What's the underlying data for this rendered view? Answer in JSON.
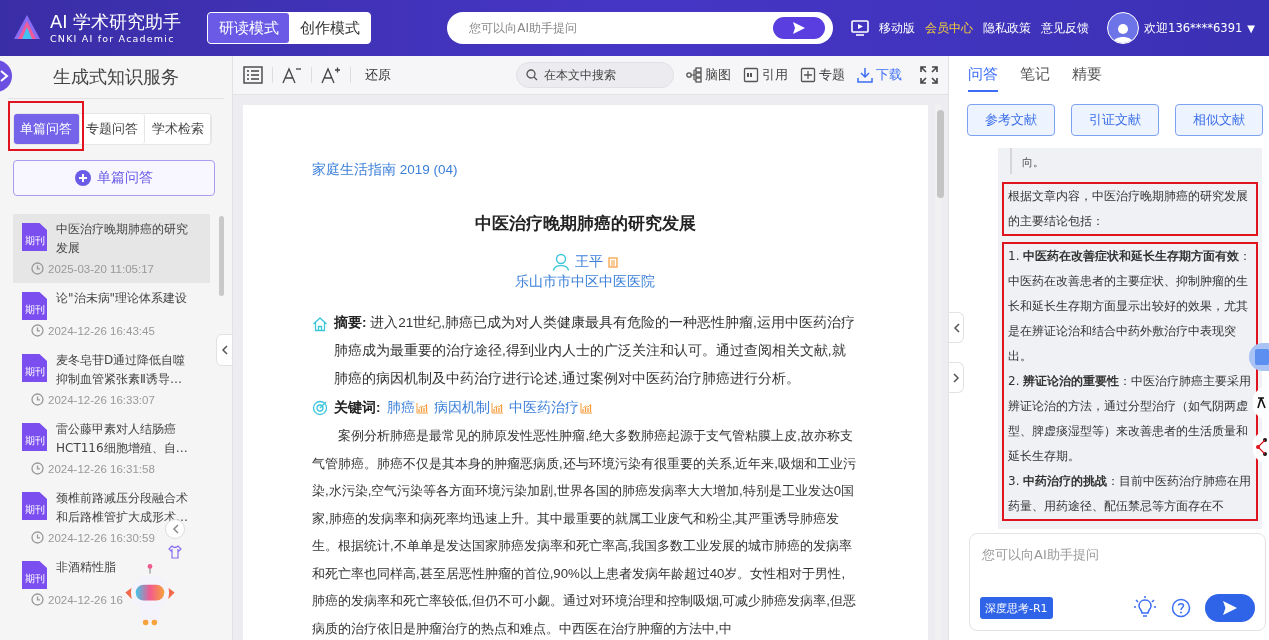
{
  "header": {
    "logo_title": "AI 学术研究助手",
    "logo_subtitle": "CNKI AI for Academic",
    "modes": [
      {
        "label": "研读模式",
        "selected": true
      },
      {
        "label": "创作模式",
        "selected": false
      }
    ],
    "search": {
      "placeholder": "您可以向AI助手提问"
    },
    "links": [
      {
        "label": "移动版",
        "kind": "mobile"
      },
      {
        "label": "会员中心",
        "kind": "member"
      },
      {
        "label": "隐私政策",
        "kind": "plain"
      },
      {
        "label": "意见反馈",
        "kind": "plain"
      }
    ],
    "user": "欢迎136****6391",
    "dropdown": "▼"
  },
  "sidebar": {
    "title": "生成式知识服务",
    "tabs": [
      {
        "label": "单篇问答",
        "selected": true,
        "framed": true
      },
      {
        "label": "专题问答",
        "selected": false,
        "framed": false
      },
      {
        "label": "学术检索",
        "selected": false,
        "framed": false
      }
    ],
    "new_button": "单篇问答",
    "history": [
      {
        "badge": "期刊",
        "title": "中医治疗晚期肺癌的研究发展",
        "time": "2025-03-20 11:05:17",
        "selected": true
      },
      {
        "badge": "期刊",
        "title": "论\"治未病\"理论体系建设",
        "time": "2024-12-26 16:43:45",
        "selected": false
      },
      {
        "badge": "期刊",
        "title": "麦冬皂苷D通过降低自噬抑制血管紧张素Ⅱ诱导…",
        "time": "2024-12-26 16:33:07",
        "selected": false
      },
      {
        "badge": "期刊",
        "title": "雷公藤甲素对人结肠癌HCT116细胞增殖、自…",
        "time": "2024-12-26 16:31:58",
        "selected": false
      },
      {
        "badge": "期刊",
        "title": "颈椎前路减压分段融合术和后路椎管扩大成形术…",
        "time": "2024-12-26 16:30:59",
        "selected": false
      },
      {
        "badge": "期刊",
        "title": "非酒精性脂",
        "time": "2024-12-26 16",
        "selected": false
      }
    ]
  },
  "toolbar": {
    "restore": "还原",
    "search": {
      "placeholder": "在本文中搜索"
    },
    "actions": [
      {
        "label": "脑图",
        "kind": "mindmap"
      },
      {
        "label": "引用",
        "kind": "cite"
      },
      {
        "label": "专题",
        "kind": "topic"
      },
      {
        "label": "下载",
        "kind": "download"
      }
    ]
  },
  "article": {
    "journal": "家庭生活指南 2019 (04)",
    "title": "中医治疗晚期肺癌的研究发展",
    "author": "王平",
    "affiliation": "乐山市市中区中医医院",
    "abstract": {
      "label": "摘要:",
      "text": "进入21世纪,肺癌已成为对人类健康最具有危险的一种恶性肿瘤,运用中医药治疗肺癌成为最重要的治疗途径,得到业内人士的广泛关注和认可。通过查阅相关文献,就肺癌的病因机制及中药治疗进行论述,通过案例对中医药治疗肺癌进行分析。"
    },
    "keywords": {
      "label": "关键词:",
      "items": [
        "肺癌",
        "病因机制",
        "中医药治疗"
      ]
    },
    "body": "案例分析肺癌是最常见的肺原发性恶性肿瘤,绝大多数肺癌起源于支气管粘膜上皮,故亦称支气管肺癌。肺癌不仅是其本身的肿瘤恶病质,还与环境污染有很重要的关系,近年来,吸烟和工业污染,水污染,空气污染等各方面环境污染加剧,世界各国的肺癌发病率大大增加,特别是工业发达0国家,肺癌的发病率和病死率均迅速上升。其中最重要的就属工业废气和粉尘,其严重诱导肺癌发生。根据统计,不单单是发达国家肺癌发病率和死亡率高,我国多数工业发展的城市肺癌的发病率和死亡率也同样高,甚至居恶性肿瘤的首位,90%以上患者发病年龄超过40岁。女性相对于男性,肺癌的发病率和死亡率较低,但仍不可小觑。通过对环境治理和控制吸烟,可减少肺癌发病率,但恶病质的治疗依旧是肿瘤治疗的热点和难点。中西医在治疗肿瘤的方法中,中"
  },
  "answer_panel": {
    "tabs": [
      {
        "label": "问答",
        "selected": true
      },
      {
        "label": "笔记",
        "selected": false
      },
      {
        "label": "精要",
        "selected": false
      }
    ],
    "buttons": [
      "参考文献",
      "引证文献",
      "相似文献"
    ],
    "quote": "向。",
    "intro": {
      "text": "根据文章内容，中医治疗晚期肺癌的研究发展的主要结论包括：",
      "framed": true
    },
    "points": {
      "framed": true,
      "items": [
        "1. **中医药在改善症状和延长生存期方面有效**：中医药在改善患者的主要症状、抑制肿瘤的生长和延长生存期方面显示出较好的效果，尤其是在辨证论治和结合中药外敷治疗中表现突出。",
        "2. **辨证论治的重要性**：中医治疗肺癌主要采用辨证论治的方法，通过分型治疗（如气阴两虚型、脾虚痰湿型等）来改善患者的生活质量和延长生存期。",
        "3. **中药治疗的挑战**：目前中医药治疗肺癌在用药量、用药途径、配伍禁忌等方面存在不"
      ]
    },
    "input": {
      "placeholder": "您可以向AI助手提问"
    },
    "deep_think": "深度思考-R1"
  }
}
